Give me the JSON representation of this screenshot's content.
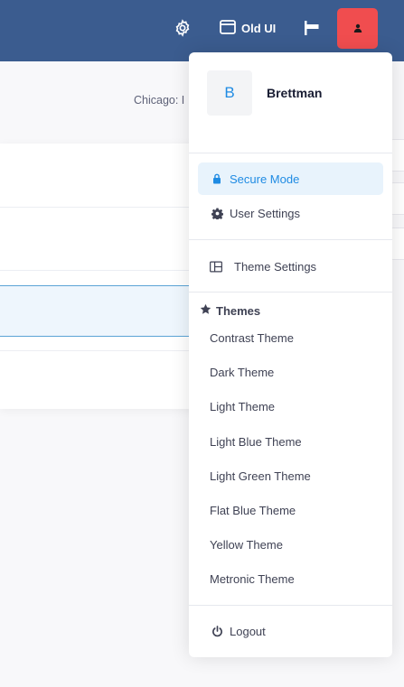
{
  "topbar": {
    "old_ui_label": "Old UI",
    "colors": {
      "bar": "#3b5c8f",
      "user_button": "#f04d4f"
    }
  },
  "page": {
    "location_text": "Chicago: I"
  },
  "menu": {
    "avatar_letter": "B",
    "user_name": "Brettman",
    "items": {
      "secure_mode": "Secure Mode",
      "user_settings": "User Settings",
      "theme_settings": "Theme Settings",
      "logout": "Logout"
    },
    "themes_header": "Themes",
    "themes": [
      "Contrast Theme",
      "Dark Theme",
      "Light Theme",
      "Light Blue Theme",
      "Light Green Theme",
      "Flat Blue Theme",
      "Yellow Theme",
      "Metronic Theme"
    ],
    "accent": "#1f8be3"
  }
}
